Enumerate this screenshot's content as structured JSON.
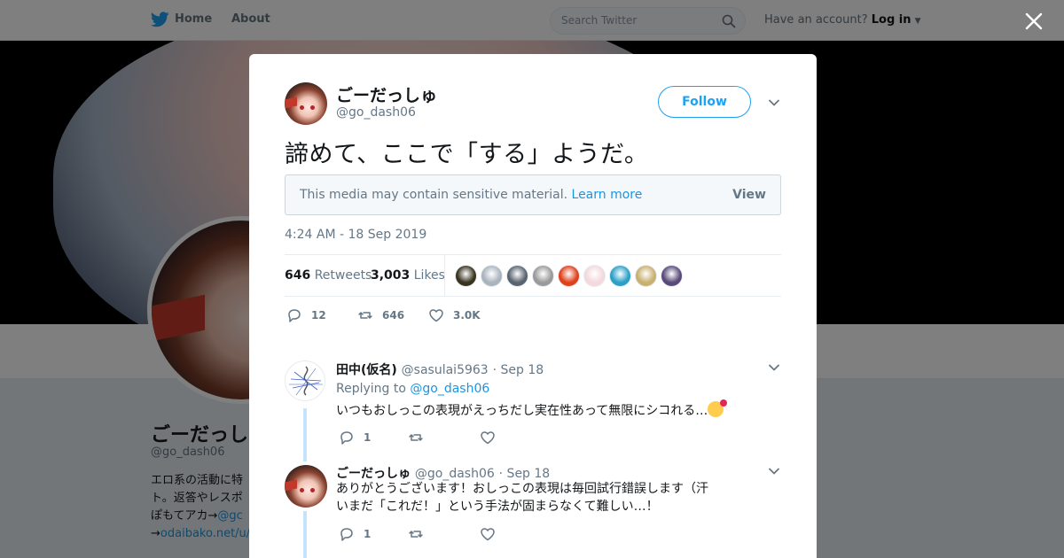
{
  "topbar": {
    "home": "Home",
    "about": "About",
    "search_placeholder": "Search Twitter",
    "have_account": "Have an account?",
    "login": "Log in"
  },
  "profile": {
    "name": "ごーだっし",
    "handle": "@go_dash06",
    "bio_line1": "エロ系の活動に特",
    "bio_line2": "ト。返答やレスポ",
    "bio_line3": "ぽもてアカ→",
    "bio_line3_link": "@gc",
    "bio_line4_prefix": "→",
    "bio_line4_link": "odaibako.net/u/"
  },
  "tweet": {
    "author_name": "ごーだっしゅ",
    "author_handle": "@go_dash06",
    "follow_label": "Follow",
    "text": "諦めて、ここで「する」ようだ。",
    "sensitive_msg": "This media may contain sensitive material.",
    "learn_more": "Learn more",
    "view_label": "View",
    "timestamp": "4:24 AM - 18 Sep 2019",
    "retweets_count": "646",
    "retweets_label": "Retweets",
    "likes_count": "3,003",
    "likes_label": "Likes",
    "replies_action": "12",
    "retweets_action": "646",
    "likes_action": "3.0K"
  },
  "likers_colors": [
    "#3a3320",
    "#a9b4bf",
    "#5a6470",
    "#9a9a9a",
    "#e0401a",
    "#f3d9de",
    "#2aa0c8",
    "#c8b070",
    "#5a4a7a"
  ],
  "replies": [
    {
      "name": "田中(仮名)",
      "handle": "@sasulai5963",
      "date": "· Sep 18",
      "replying_to_label": "Replying to",
      "replying_to": "@go_dash06",
      "text": "いつもおしっこの表現がえっちだし実在性あって無限にシコれる…",
      "reply_count": "1"
    },
    {
      "name": "ごーだっしゅ",
      "handle": "@go_dash06",
      "date": "· Sep 18",
      "text_line1": "ありがとうございます！おしっこの表現は毎回試行錯誤します（汗",
      "text_line2": "いまだ「これだ！」という手法が固まらなくて難しい…！",
      "reply_count": "1"
    }
  ]
}
